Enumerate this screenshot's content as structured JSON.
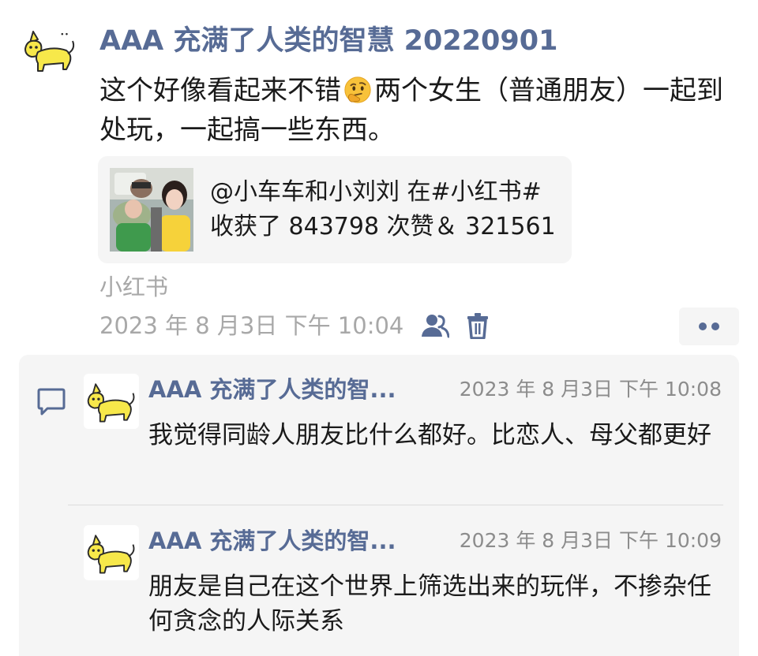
{
  "post": {
    "username": "AAA 充满了人类的智慧 20220901",
    "text_before_emoji": "这个好像看起来不错",
    "emoji": "thinking-face-emoji",
    "text_after_emoji": "两个女生（普通朋友）一起到处玩，一起搞一些东西。",
    "link": {
      "line1": "@小车车和小刘刘 在#小红书#",
      "line2": "收获了 843798 次赞＆ 321561"
    },
    "source": "小红书",
    "timestamp": "2023 年 8 月3日 下午 10:04",
    "icons": {
      "visibility": "friends-visibility-icon",
      "delete": "trash-icon",
      "more": "more-dots-icon",
      "comment": "comment-bubble-icon"
    }
  },
  "comments": [
    {
      "username": "AAA 充满了人类的智...",
      "time": "2023 年 8 月3日 下午 10:08",
      "text": "我觉得同龄人朋友比什么都好。比恋人、母父都更好"
    },
    {
      "username": "AAA 充满了人类的智...",
      "time": "2023 年 8 月3日 下午 10:09",
      "text": "朋友是自己在这个世界上筛选出来的玩伴，不掺杂任何贪念的人际关系"
    }
  ],
  "colors": {
    "link_blue": "#576b95",
    "meta_gray": "#a8a8a8",
    "panel_bg": "#f5f5f5",
    "cat_yellow": "#f7e84a"
  }
}
